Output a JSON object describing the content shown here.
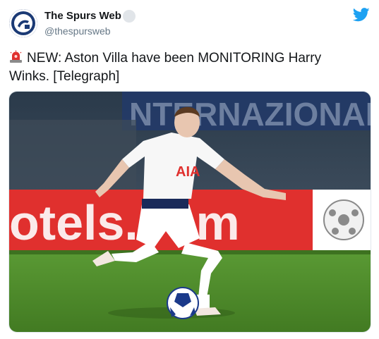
{
  "account": {
    "display_name": "The Spurs Web",
    "handle": "@thespursweb",
    "avatar_icon": "spurs-web-logo",
    "verified_icon": "badge-icon"
  },
  "tweet": {
    "emoji": "rotating-light",
    "text": "NEW: Aston Villa have been MONITORING Harry Winks. [Telegraph]"
  },
  "media": {
    "alt": "Footballer in white kit about to kick a Champions League ball",
    "sponsor_text": "AIA",
    "board_text": "otels.com",
    "stand_text": "NTERNAZIONALE"
  },
  "colors": {
    "twitter_blue": "#1da1f2",
    "handle_gray": "#657786",
    "pitch_green": "#4e8a2a",
    "board_red": "#e0302e"
  }
}
